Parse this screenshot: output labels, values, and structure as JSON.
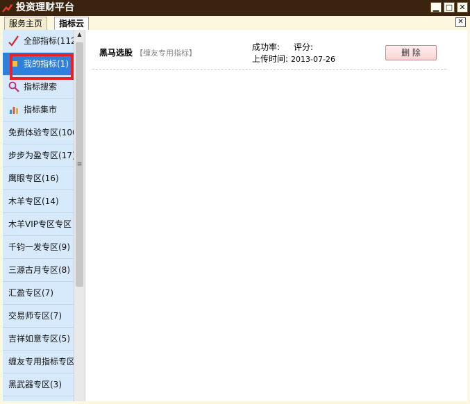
{
  "window": {
    "title": "投资理财平台",
    "min_label": "▁",
    "max_label": "□",
    "close_label": "✕"
  },
  "tabs": [
    {
      "label": "服务主页",
      "active": false
    },
    {
      "label": "指标云",
      "active": true
    }
  ],
  "tab_close_label": "✕",
  "sidebar": {
    "items": [
      {
        "label": "全部指标(112",
        "icon": "check-mark-icon"
      },
      {
        "label": "我的指标(1)",
        "icon": "my-indicator-icon",
        "active": true
      },
      {
        "label": "指标搜索",
        "icon": "search-icon"
      },
      {
        "label": "指标集市",
        "icon": "bar-chart-icon"
      },
      {
        "label": "免费体验专区(100"
      },
      {
        "label": "步步为盈专区(17)"
      },
      {
        "label": "鹰眼专区(16)"
      },
      {
        "label": "木羊专区(14)"
      },
      {
        "label": "木羊VIP专区专区"
      },
      {
        "label": "千钧一发专区(9)"
      },
      {
        "label": "三源古月专区(8)"
      },
      {
        "label": "汇盈专区(7)"
      },
      {
        "label": "交易师专区(7)"
      },
      {
        "label": "吉祥如意专区(5)"
      },
      {
        "label": "缠友专用指标专区"
      },
      {
        "label": "黑武器专区(3)"
      }
    ]
  },
  "scrollbar": {
    "up_label": "▲",
    "grip_label": "≡"
  },
  "indicator": {
    "name": "黑马选股",
    "tag": "【缠友专用指标】",
    "success_label": "成功率:",
    "rating_label": "评分:",
    "upload_label": "上传时间:",
    "upload_date": "2013-07-26",
    "delete_label": "删 除"
  },
  "colors": {
    "title_bar": "#3a2410",
    "sidebar_bg": "#d7eafb",
    "sidebar_active": "#2f7fdc",
    "highlight": "#e8202a"
  }
}
